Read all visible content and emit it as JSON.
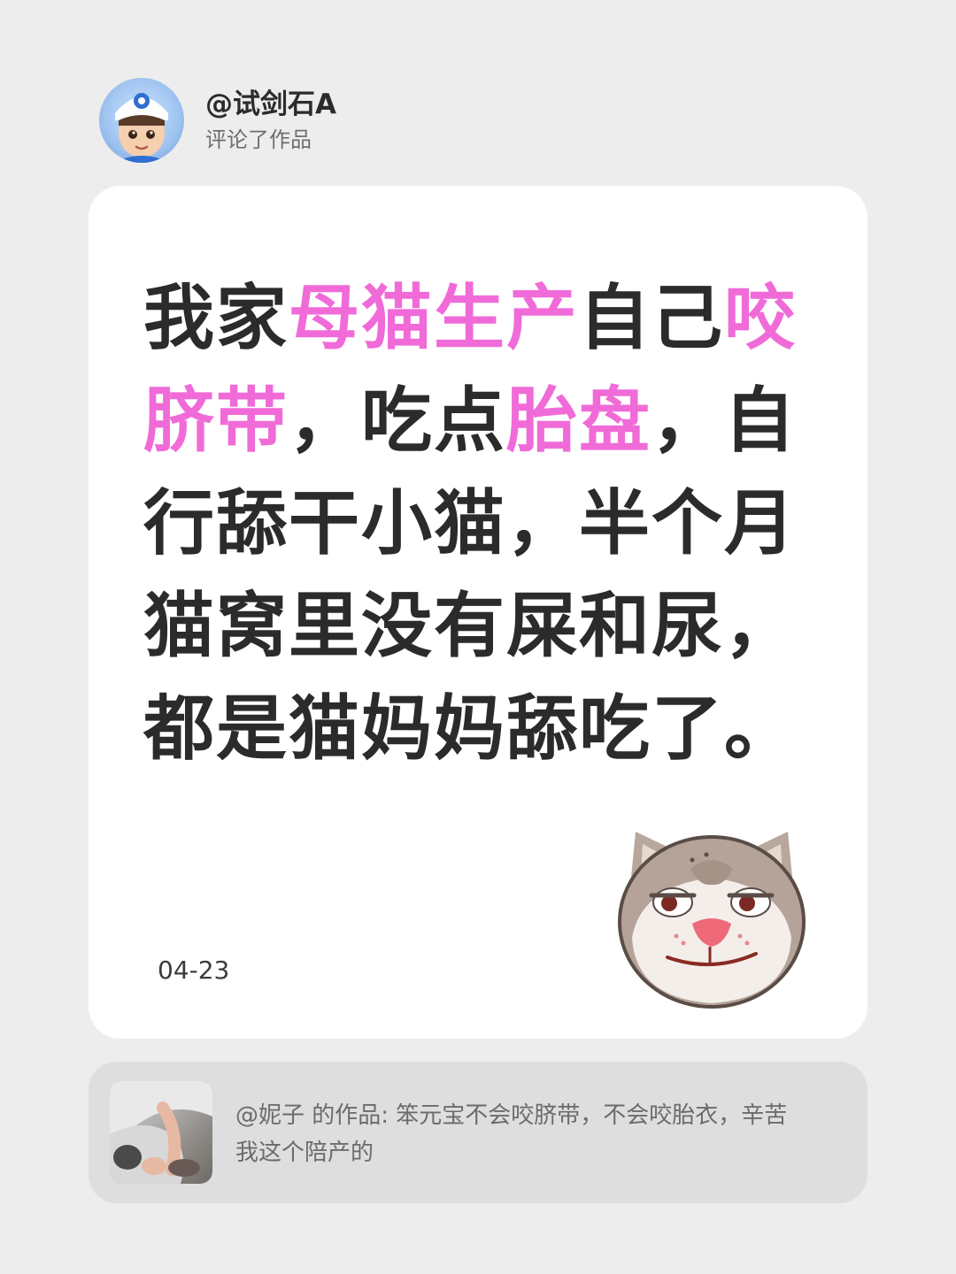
{
  "user": {
    "username": "@试剑石A",
    "action": "评论了作品"
  },
  "comment": {
    "segments": [
      {
        "text": "我家",
        "highlight": false
      },
      {
        "text": "母猫生产",
        "highlight": true
      },
      {
        "text": "自己",
        "highlight": false
      },
      {
        "text": "咬脐带",
        "highlight": true
      },
      {
        "text": "，吃点",
        "highlight": false
      },
      {
        "text": "胎盘",
        "highlight": true
      },
      {
        "text": "，自行舔干小猫，半个月猫窝里没有屎和尿，都是猫妈妈舔吃了。",
        "highlight": false
      }
    ],
    "date": "04-23",
    "emoji": "cat-smirk-icon",
    "highlight_color": "#f06bd8"
  },
  "reference": {
    "text": "@妮子 的作品: 笨元宝不会咬脐带，不会咬胎衣，辛苦我这个陪产的"
  }
}
